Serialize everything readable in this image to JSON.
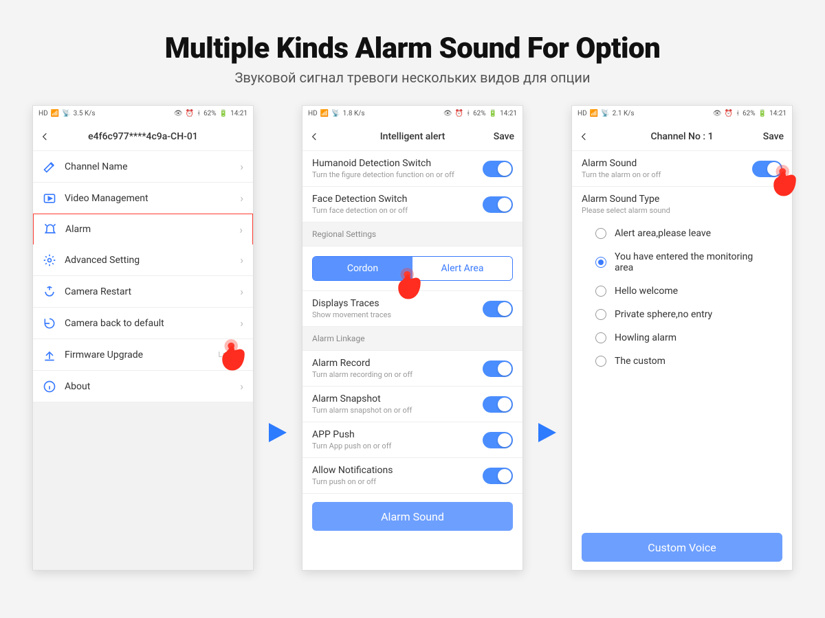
{
  "heading": {
    "title": "Multiple Kinds Alarm Sound For Option",
    "subtitle": "Звуковой сигнал тревоги нескольких видов для опции"
  },
  "statusbar": {
    "left": "HD  ⁴⁶  ⁴⁶",
    "signal": "ııl",
    "wifi": "�member",
    "speed1": "3.5",
    "speed2": "1.8",
    "speed3": "2.1",
    "speedUnit": "K/s",
    "icons": "👁 ⦿ ✱",
    "battery": "62%",
    "time": "14:21"
  },
  "phone1": {
    "title": "e4f6c977****4c9a-CH-01",
    "rows": {
      "r0": "Channel Name",
      "r1": "Video Management",
      "r2": "Alarm",
      "r3": "Advanced Setting",
      "r4": "Camera Restart",
      "r5": "Camera back to default",
      "r6": "Firmware Upgrade",
      "r6_badge": "Latest",
      "r7": "About"
    }
  },
  "phone2": {
    "title": "Intelligent alert",
    "save": "Save",
    "humanoid_t": "Humanoid Detection Switch",
    "humanoid_d": "Turn the figure detection function on or off",
    "face_t": "Face Detection Switch",
    "face_d": "Turn face detection on or off",
    "regional_hdr": "Regional Settings",
    "seg_cordon": "Cordon",
    "seg_alert": "Alert Area",
    "traces_t": "Displays Traces",
    "traces_d": "Show movement traces",
    "linkage_hdr": "Alarm Linkage",
    "record_t": "Alarm Record",
    "record_d": "Turn alarm recording on or off",
    "snap_t": "Alarm Snapshot",
    "snap_d": "Turn alarm snapshot on or off",
    "push_t": "APP Push",
    "push_d": "Turn App push on or off",
    "notif_t": "Allow Notifications",
    "notif_d": "Turn push on or off",
    "btn": "Alarm Sound"
  },
  "phone3": {
    "title": "Channel No : 1",
    "save": "Save",
    "sound_t": "Alarm Sound",
    "sound_d": "Turn the alarm on or off",
    "type_t": "Alarm Sound Type",
    "type_d": "Please select alarm sound",
    "opt0": "Alert area,please leave",
    "opt1": "You have entered the monitoring area",
    "opt2": "Hello welcome",
    "opt3": "Private sphere,no entry",
    "opt4": "Howling alarm",
    "opt5": "The custom",
    "btn": "Custom Voice"
  }
}
